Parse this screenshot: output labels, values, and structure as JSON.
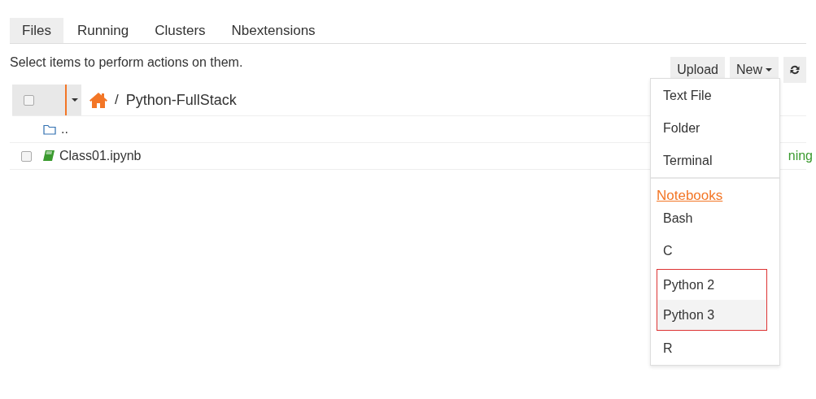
{
  "tabs": [
    {
      "label": "Files",
      "selected": true
    },
    {
      "label": "Running",
      "selected": false
    },
    {
      "label": "Clusters",
      "selected": false
    },
    {
      "label": "Nbextensions",
      "selected": false
    }
  ],
  "message": "Select items to perform actions on them.",
  "toolbar": {
    "upload": "Upload",
    "new": "New"
  },
  "select_all": {
    "checked": false
  },
  "breadcrumb": {
    "separator": "/",
    "folder": "Python-FullStack"
  },
  "files": [
    {
      "kind": "parent",
      "name": ".."
    },
    {
      "kind": "notebook",
      "name": "Class01.ipynb",
      "checked": false,
      "status": "ning"
    }
  ],
  "new_menu": {
    "groups": [
      {
        "items": [
          {
            "label": "Text File",
            "selected": false,
            "framed": false
          },
          {
            "label": "Folder",
            "selected": false,
            "framed": false
          },
          {
            "label": "Terminal",
            "selected": false,
            "framed": false
          }
        ]
      },
      {
        "header": "Notebooks",
        "items": [
          {
            "label": "Bash",
            "selected": false,
            "framed": false
          },
          {
            "label": "C",
            "selected": false,
            "framed": false
          },
          {
            "label": "Python 2",
            "selected": false,
            "framed": true
          },
          {
            "label": "Python 3",
            "selected": true,
            "framed": true
          },
          {
            "label": "R",
            "selected": false,
            "framed": false
          }
        ]
      }
    ]
  }
}
